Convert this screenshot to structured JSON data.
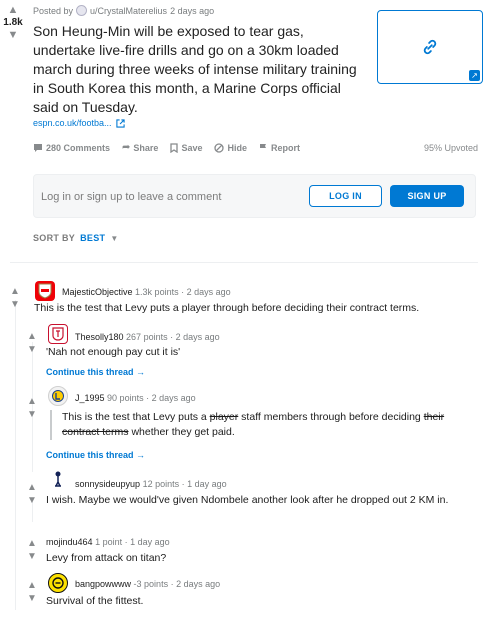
{
  "post": {
    "score": "1.8k",
    "posted_by_prefix": "Posted by",
    "author": "u/CrystalMaterelius",
    "age": "2 days ago",
    "title": "Son Heung-Min will be exposed to tear gas, undertake live-fire drills and go on a 30km loaded march during three weeks of intense military training in South Korea this month, a Marine Corps official said on Tuesday.",
    "domain": "espn.co.uk/footba...",
    "actions": {
      "comments": "280 Comments",
      "share": "Share",
      "save": "Save",
      "hide": "Hide",
      "report": "Report"
    },
    "upvoted": "95% Upvoted"
  },
  "comment_box": {
    "prompt": "Log in or sign up to leave a comment",
    "login": "LOG IN",
    "signup": "SIGN UP"
  },
  "sort": {
    "label": "SORT BY",
    "value": "BEST"
  },
  "comments": [
    {
      "author": "MajesticObjective",
      "points": "1.3k points",
      "age": "2 days ago",
      "body": "This is the test that Levy puts a player through before deciding their contract terms."
    },
    {
      "author": "Thesolly180",
      "points": "267 points",
      "age": "2 days ago",
      "body": "'Nah not enough pay cut it is'",
      "continue": "Continue this thread →"
    },
    {
      "author": "J_1995",
      "points": "90 points",
      "age": "2 days ago",
      "body_a": "This is the test that Levy puts a ",
      "body_strike1": "player",
      "body_b": " staff members through before deciding ",
      "body_strike2": "their contract terms",
      "body_c": " whether they get paid.",
      "continue": "Continue this thread →"
    },
    {
      "author": "sonnysideupyup",
      "points": "12 points",
      "age": "1 day ago",
      "body": "I wish. Maybe we would've given Ndombele another look after he dropped out 2 KM in."
    },
    {
      "author": "mojindu464",
      "points": "1 point",
      "age": "1 day ago",
      "body": "Levy from attack on titan?"
    },
    {
      "author": "bangpowwww",
      "points": "-3 points",
      "age": "2 days ago",
      "body": "Survival of the fittest."
    }
  ],
  "colors": {
    "accent": "#0079d3",
    "muted": "#878a8c"
  }
}
